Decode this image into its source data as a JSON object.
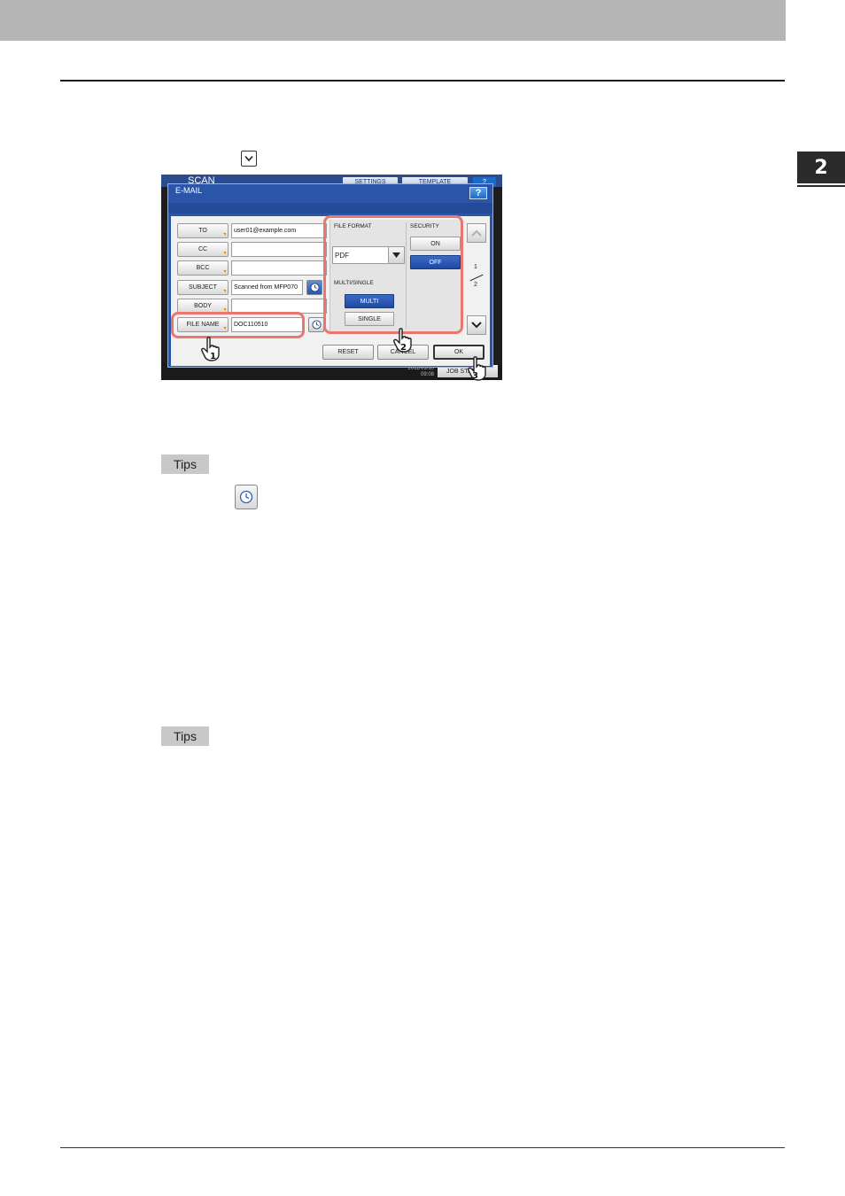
{
  "chapter": {
    "number": "2"
  },
  "screen": {
    "background": {
      "app_title": "SCAN",
      "settings_label": "SETTINGS",
      "template_label": "TEMPLATE",
      "help_label": "?",
      "time": "2011/03/10\n09:08",
      "job_status_label": "JOB STATUS"
    },
    "dialog": {
      "title": "E-MAIL",
      "help_label": "?",
      "fields": [
        {
          "label": "TO",
          "value": "user01@example.com"
        },
        {
          "label": "CC",
          "value": ""
        },
        {
          "label": "BCC",
          "value": ""
        },
        {
          "label": "SUBJECT",
          "value": "Scanned from MFP070"
        },
        {
          "label": "BODY",
          "value": ""
        },
        {
          "label": "FILE NAME",
          "value": "DOC110510"
        }
      ],
      "file_format": {
        "label": "FILE FORMAT",
        "value": "PDF"
      },
      "multi_single": {
        "label": "MULTI/SINGLE",
        "multi": "MULTI",
        "single": "SINGLE"
      },
      "security": {
        "label": "SECURITY",
        "on": "ON",
        "off": "OFF"
      },
      "page": {
        "current": "1",
        "total": "2"
      },
      "actions": {
        "reset": "RESET",
        "cancel": "CANCEL",
        "ok": "OK"
      }
    },
    "steps": {
      "one": "1",
      "two": "2",
      "three": "3"
    }
  },
  "tips": [
    "Tips",
    "Tips"
  ],
  "colors": {
    "highlight": "#e8776f",
    "dialog_blue": "#2a55a8",
    "selected_blue": "#1e4aa0",
    "header_gray": "#b5b5b5"
  }
}
